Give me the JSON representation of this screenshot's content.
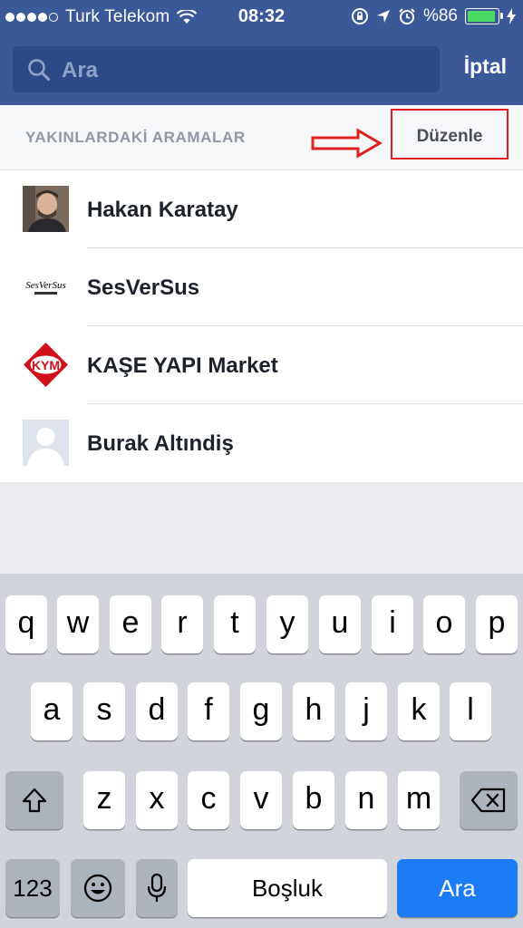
{
  "status_bar": {
    "carrier": "Turk Telekom",
    "time": "08:32",
    "battery": "%86",
    "signal_dots_filled": 4,
    "signal_dots_total": 5,
    "battery_level": 0.86
  },
  "search": {
    "placeholder": "Ara",
    "cancel_label": "İptal"
  },
  "recent": {
    "section_title": "YAKINLARDAKİ ARAMALAR",
    "edit_label": "Düzenle",
    "items": [
      {
        "name": "Hakan Karatay",
        "icon": "profile-photo"
      },
      {
        "name": "SesVerSus",
        "icon": "brand-logo",
        "logo_text": "SesVerSus"
      },
      {
        "name": "KAŞE YAPI Market",
        "icon": "brand-logo",
        "logo_text": "KYM"
      },
      {
        "name": "Burak Altındiş",
        "icon": "default-avatar"
      }
    ]
  },
  "keyboard": {
    "row1": [
      "q",
      "w",
      "e",
      "r",
      "t",
      "y",
      "u",
      "i",
      "o",
      "p"
    ],
    "row2": [
      "a",
      "s",
      "d",
      "f",
      "g",
      "h",
      "j",
      "k",
      "l"
    ],
    "row3": [
      "z",
      "x",
      "c",
      "v",
      "b",
      "n",
      "m"
    ],
    "numbers_label": "123",
    "space_label": "Boşluk",
    "search_label": "Ara"
  },
  "colors": {
    "header": "#3b5998",
    "search_field": "#2e4a86",
    "annotation": "#e02020",
    "keyboard_action": "#1b7cf5"
  }
}
